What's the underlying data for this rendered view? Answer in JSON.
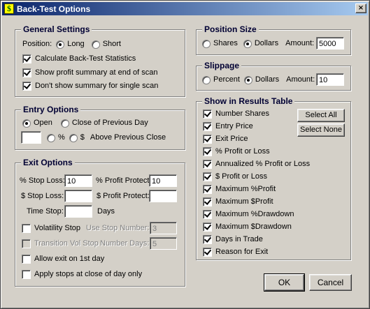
{
  "window": {
    "title": "Back-Test Options",
    "close_glyph": "×",
    "icon": "$"
  },
  "general": {
    "title": "General Settings",
    "position_label": "Position:",
    "long_label": "Long",
    "short_label": "Short",
    "position_selected": "Long",
    "calc_stats_label": "Calculate Back-Test Statistics",
    "show_summary_label": "Show profit summary at end of scan",
    "dont_show_label": "Don't show summary for single scan"
  },
  "entry": {
    "title": "Entry Options",
    "open_label": "Open",
    "close_prev_label": "Close of Previous Day",
    "pct_label": "%",
    "dollar_label": "$",
    "above_prev_label": "Above Previous Close",
    "value": ""
  },
  "exit": {
    "title": "Exit Options",
    "pct_stop_loss_label": "% Stop Loss:",
    "pct_stop_loss_value": "10",
    "pct_profit_protect_label": "% Profit Protect:",
    "pct_profit_protect_value": "10",
    "dollar_stop_loss_label": "$ Stop Loss:",
    "dollar_stop_loss_value": "",
    "dollar_profit_protect_label": "$ Profit Protect:",
    "dollar_profit_protect_value": "",
    "time_stop_label": "Time Stop:",
    "time_stop_value": "",
    "days_label": "Days",
    "volatility_stop_label": "Volatility Stop",
    "use_stop_number_label": "Use Stop Number:",
    "use_stop_number_value": "3",
    "transition_vol_stop_label": "Transition Vol Stop",
    "number_days_label": "Number Days:",
    "number_days_value": "5",
    "allow_exit_label": "Allow exit on 1st day",
    "apply_stops_label": "Apply stops at close of day only"
  },
  "position_size": {
    "title": "Position Size",
    "shares_label": "Shares",
    "dollars_label": "Dollars",
    "selected": "Dollars",
    "amount_label": "Amount:",
    "amount_value": "5000"
  },
  "slippage": {
    "title": "Slippage",
    "percent_label": "Percent",
    "dollars_label": "Dollars",
    "selected": "Dollars",
    "amount_label": "Amount:",
    "amount_value": "10"
  },
  "results": {
    "title": "Show in Results Table",
    "select_all_label": "Select All",
    "select_none_label": "Select None",
    "items": [
      "Number Shares",
      "Entry Price",
      "Exit Price",
      "% Profit or Loss",
      "Annualized % Profit or Loss",
      "$ Profit or Loss",
      "Maximum %Profit",
      "Maximum $Profit",
      "Maximum %Drawdown",
      "Maximum $Drawdown",
      "Days in Trade",
      "Reason for Exit"
    ]
  },
  "buttons": {
    "ok_label": "OK",
    "cancel_label": "Cancel"
  }
}
